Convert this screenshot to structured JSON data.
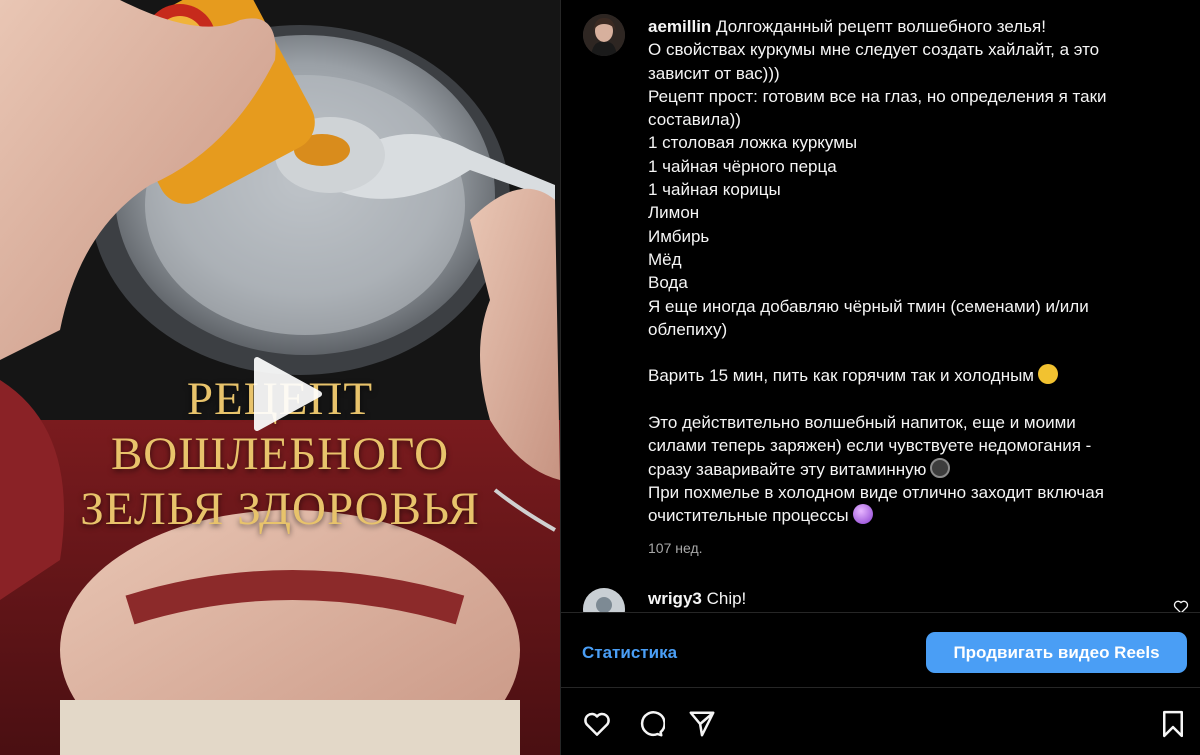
{
  "video": {
    "overlay_title": [
      "РЕЦЕПТ",
      "ВОШЛЕБНОГО",
      "ЗЕЛЬЯ ЗДОРОВЬЯ"
    ]
  },
  "post": {
    "username": "aemillin",
    "caption_lines": [
      "Долгожданный рецепт волшебного зелья!",
      "О свойствах куркумы мне следует создать хайлайт, а это",
      "зависит от вас)))",
      "Рецепт прост: готовим все на глаз, но определения я таки",
      "составила))",
      "1 столовая ложка куркумы",
      "1 чайная чёрного перца",
      "1 чайная корицы",
      "Лимон",
      "Имбирь",
      "Мёд",
      "Вода",
      "Я еще иногда добавляю чёрный тмин (семенами) и/или",
      "облепиху)"
    ],
    "paragraph2": "Варить 15 мин, пить как горячим так и холодным",
    "paragraph3_lines": [
      "Это действительно волшебный напиток, еще и моими",
      "силами теперь заряжен) если чувствуете недомогания -",
      "сразу заваривайте эту витаминную",
      "При похмелье в холодном виде отлично заходит включая",
      "очистительные процессы"
    ],
    "time": "107 нед."
  },
  "comment": {
    "username": "wrigy3",
    "text": "Chip!"
  },
  "footer": {
    "stats_label": "Статистика",
    "promote_label": "Продвигать видео Reels"
  },
  "icons": {
    "emoji_hug": "hugging-face-emoji",
    "emoji_bomb": "bomb-emoji",
    "emoji_ball": "crystal-ball-emoji"
  },
  "colors": {
    "accent": "#4a9ef5",
    "title_gold": "#e8c36b",
    "muted": "#a8a8a8"
  }
}
